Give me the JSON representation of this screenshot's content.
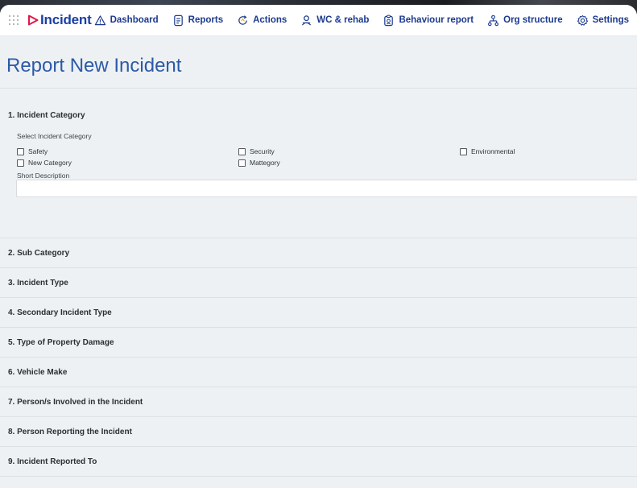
{
  "app": {
    "brand_name": "Incident",
    "brand_color": "#1a3fa6",
    "accent_color": "#e0184a"
  },
  "nav": {
    "items": [
      {
        "label": "Dashboard",
        "icon": "warning-triangle-icon"
      },
      {
        "label": "Reports",
        "icon": "report-document-icon"
      },
      {
        "label": "Actions",
        "icon": "actions-refresh-icon"
      },
      {
        "label": "WC & rehab",
        "icon": "person-rehab-icon"
      },
      {
        "label": "Behaviour report",
        "icon": "clipboard-icon"
      },
      {
        "label": "Org structure",
        "icon": "org-chart-icon"
      },
      {
        "label": "Settings",
        "icon": "gear-icon"
      }
    ]
  },
  "page": {
    "title": "Report New Incident"
  },
  "section1": {
    "title": "1. Incident Category",
    "select_label": "Select Incident Category",
    "checkboxes": [
      {
        "label": "Safety",
        "checked": false
      },
      {
        "label": "Security",
        "checked": false
      },
      {
        "label": "Environmental",
        "checked": false
      },
      {
        "label": "New Category",
        "checked": false
      },
      {
        "label": "Mattegory",
        "checked": false
      }
    ],
    "short_description_label": "Short Description",
    "short_description_value": ""
  },
  "sections": [
    {
      "label": "2. Sub Category"
    },
    {
      "label": "3. Incident Type"
    },
    {
      "label": "4. Secondary Incident Type"
    },
    {
      "label": "5. Type of Property Damage"
    },
    {
      "label": "6. Vehicle Make"
    },
    {
      "label": "7. Person/s Involved in the Incident"
    },
    {
      "label": "8. Person Reporting the Incident"
    },
    {
      "label": "9. Incident Reported To"
    }
  ]
}
